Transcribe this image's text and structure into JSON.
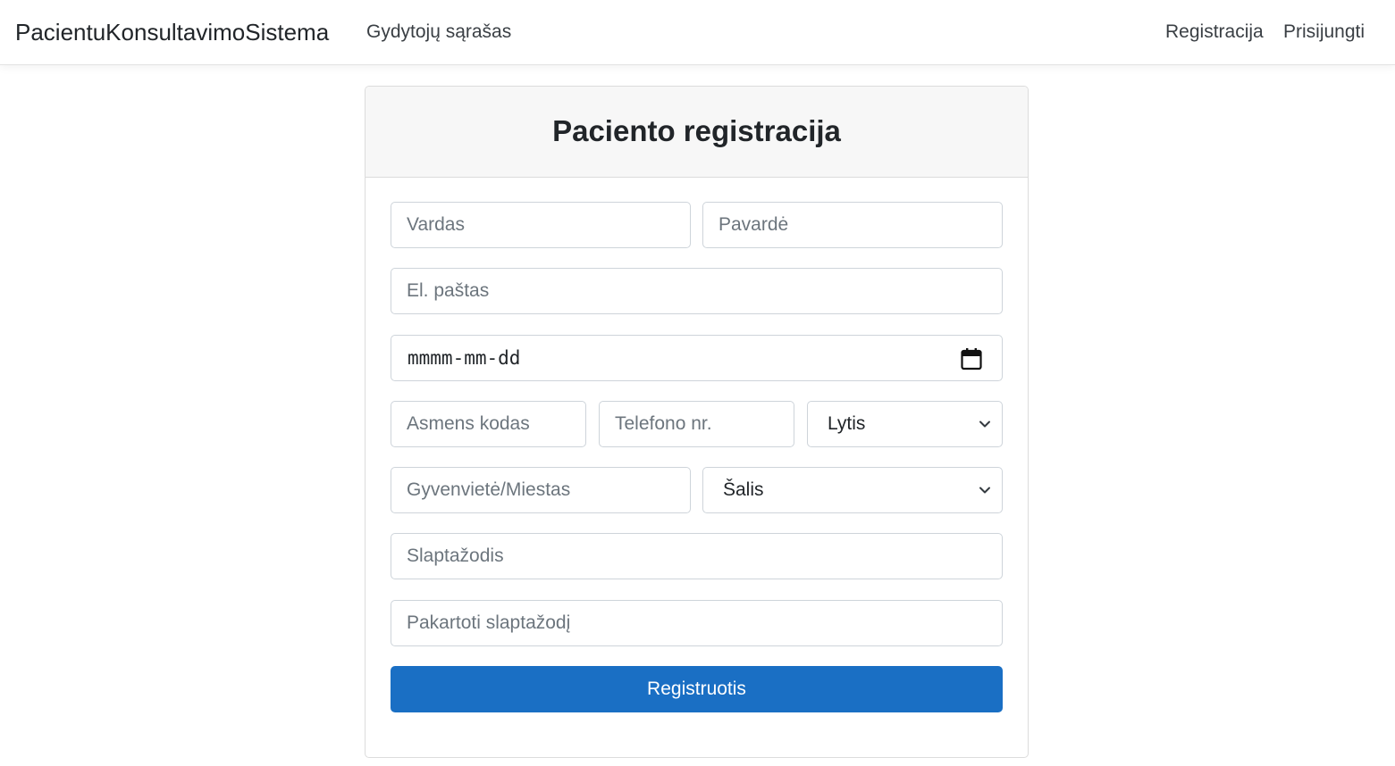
{
  "navbar": {
    "brand": "PacientuKonsultavimoSistema",
    "doctors_link": "Gydytojų sąrašas",
    "register_link": "Registracija",
    "login_link": "Prisijungti"
  },
  "form": {
    "title": "Paciento registracija",
    "first_name_placeholder": "Vardas",
    "last_name_placeholder": "Pavardė",
    "email_placeholder": "El. paštas",
    "birth_date_placeholder": "mmmm-mm-dd",
    "personal_code_placeholder": "Asmens kodas",
    "phone_placeholder": "Telefono nr.",
    "gender_select": "Lytis",
    "city_placeholder": "Gyvenvietė/Miestas",
    "country_select": "Šalis",
    "password_placeholder": "Slaptažodis",
    "repeat_password_placeholder": "Pakartoti slaptažodį",
    "submit_label": "Registruotis"
  },
  "icons": {
    "calendar": "calendar-icon",
    "chevron": "chevron-down-icon"
  },
  "colors": {
    "primary": "#1a6fc4",
    "header_bg": "#f7f7f7",
    "border": "#ced4da",
    "placeholder": "#6c757d"
  }
}
